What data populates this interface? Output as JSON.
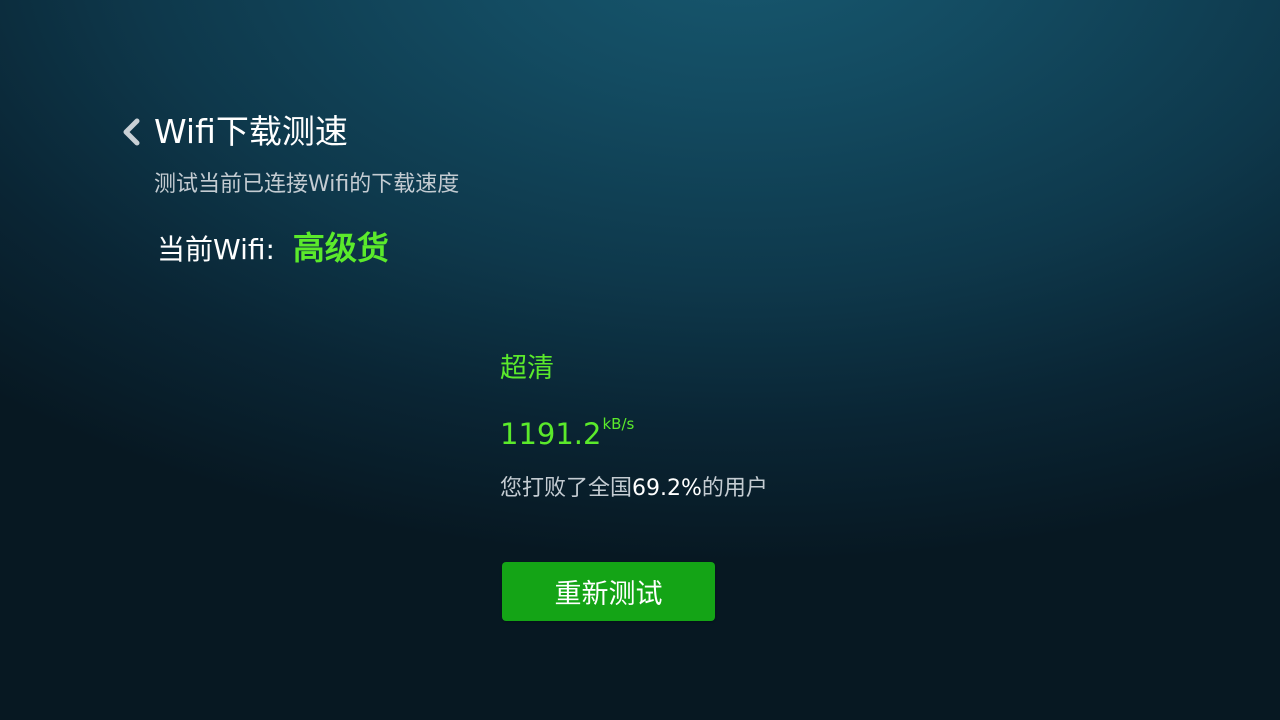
{
  "header": {
    "back_icon": "chevron-left-icon",
    "title": "Wifi下载测速",
    "subtitle": "测试当前已连接Wifi的下载速度"
  },
  "wifi": {
    "label": "当前Wifi:",
    "name": "高级货"
  },
  "result": {
    "quality": "超清",
    "speed_value": "1191.2",
    "speed_unit": "kB/s",
    "beat_prefix": "您打败了全国",
    "beat_percent": "69.2%",
    "beat_suffix": "的用户"
  },
  "actions": {
    "retest_label": "重新测试"
  },
  "colors": {
    "accent_green": "#5bea2b",
    "button_green": "#14a416",
    "background_top": "#17586f",
    "background_bottom": "#071822"
  }
}
